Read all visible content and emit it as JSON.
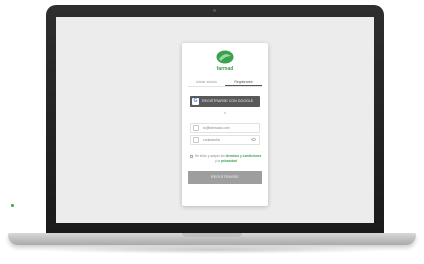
{
  "app": {
    "brand_name": "farmad"
  },
  "tabs": [
    {
      "label": "Iniciar sesión"
    },
    {
      "label": "Registrarse"
    }
  ],
  "google_button": {
    "icon": "google-g-icon",
    "label": "REGISTRARSE CON GOOGLE"
  },
  "divider": "o",
  "email_field": {
    "value": "tu@farmacia.com"
  },
  "password_field": {
    "value": "contraseña"
  },
  "terms": {
    "prefix": "He leído y acepto los",
    "link1": "términos y condiciones",
    "middle": "y la",
    "link2": "privacidad"
  },
  "submit_button": {
    "label": "REGISTRARSE"
  },
  "colors": {
    "brand": "#3aa24a",
    "google_button": "#595959",
    "submit_button": "#9e9e9e"
  }
}
